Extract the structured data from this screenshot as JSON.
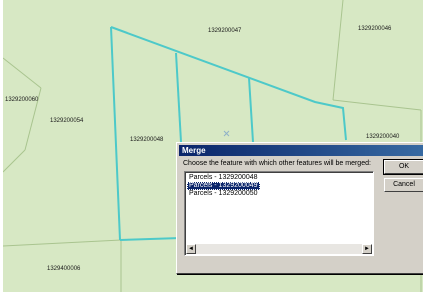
{
  "map": {
    "parcels": [
      {
        "id": "1329200047"
      },
      {
        "id": "1329200046"
      },
      {
        "id": "1329200060"
      },
      {
        "id": "1329200054"
      },
      {
        "id": "1329200048"
      },
      {
        "id": "1329200040"
      },
      {
        "id": "1329400006"
      }
    ],
    "colors": {
      "background": "#d7e8c4",
      "boundary": "#a9c48f",
      "highlight": "#4dc9c9"
    },
    "marker_icon": "x-marker-icon"
  },
  "dialog": {
    "title": "Merge",
    "prompt": "Choose the feature with which other features will be merged:",
    "items": [
      {
        "label": "Parcels - 1329200048",
        "selected": false
      },
      {
        "label": "Parcels - 1329200049",
        "selected": true
      },
      {
        "label": "Parcels - 1329200050",
        "selected": false
      }
    ],
    "ok_label": "OK",
    "cancel_label": "Cancel",
    "scroll_left_icon": "◄",
    "scroll_right_icon": "►",
    "colors": {
      "face": "#d4d0c8",
      "title_bar": "#0a246a",
      "selection": "#0a246a"
    }
  }
}
